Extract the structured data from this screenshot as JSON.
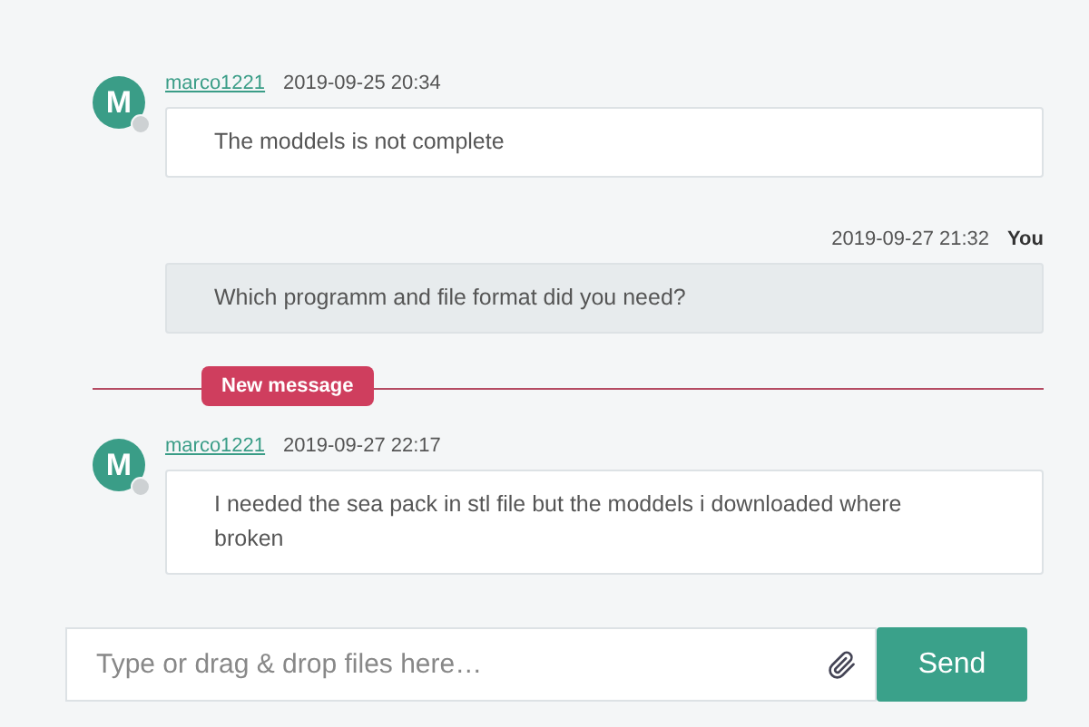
{
  "messages": [
    {
      "kind": "incoming",
      "avatar": "M",
      "online": false,
      "author": "marco1221",
      "time": "2019-09-25 20:34",
      "text": "The moddels is not complete"
    },
    {
      "kind": "outgoing",
      "author": "You",
      "time": "2019-09-27 21:32",
      "text": "Which programm and file format did you need?"
    },
    {
      "kind": "divider",
      "label": "New message"
    },
    {
      "kind": "incoming",
      "avatar": "M",
      "online": false,
      "author": "marco1221",
      "time": "2019-09-27 22:17",
      "text": "I needed the sea pack in stl file but the moddels i downloaded where broken"
    }
  ],
  "composer": {
    "placeholder": "Type or drag & drop files here…",
    "send": "Send"
  }
}
